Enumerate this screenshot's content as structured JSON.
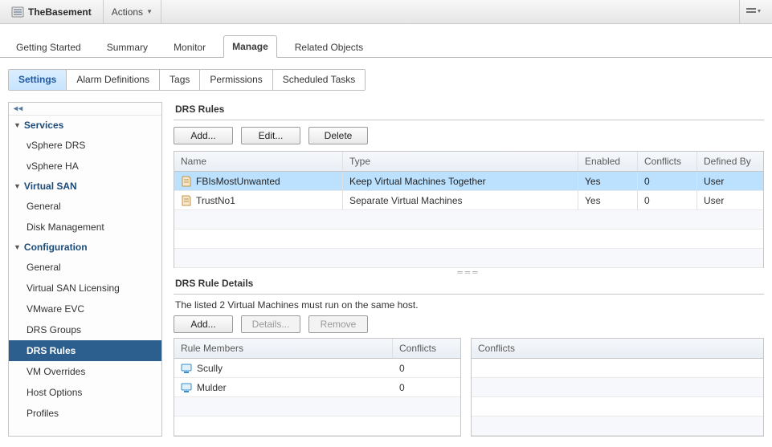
{
  "header": {
    "title": "TheBasement",
    "actions_label": "Actions"
  },
  "main_tabs": [
    {
      "label": "Getting Started",
      "active": false
    },
    {
      "label": "Summary",
      "active": false
    },
    {
      "label": "Monitor",
      "active": false
    },
    {
      "label": "Manage",
      "active": true
    },
    {
      "label": "Related Objects",
      "active": false
    }
  ],
  "sub_tabs": [
    {
      "label": "Settings",
      "active": true
    },
    {
      "label": "Alarm Definitions",
      "active": false
    },
    {
      "label": "Tags",
      "active": false
    },
    {
      "label": "Permissions",
      "active": false
    },
    {
      "label": "Scheduled Tasks",
      "active": false
    }
  ],
  "sidebar": {
    "sections": [
      {
        "label": "Services",
        "items": [
          {
            "label": "vSphere DRS"
          },
          {
            "label": "vSphere HA"
          }
        ]
      },
      {
        "label": "Virtual SAN",
        "items": [
          {
            "label": "General"
          },
          {
            "label": "Disk Management"
          }
        ]
      },
      {
        "label": "Configuration",
        "items": [
          {
            "label": "General"
          },
          {
            "label": "Virtual SAN Licensing"
          },
          {
            "label": "VMware EVC"
          },
          {
            "label": "DRS Groups"
          },
          {
            "label": "DRS Rules",
            "active": true
          },
          {
            "label": "VM Overrides"
          },
          {
            "label": "Host Options"
          },
          {
            "label": "Profiles"
          }
        ]
      }
    ]
  },
  "rules_panel": {
    "title": "DRS Rules",
    "toolbar": {
      "add": "Add...",
      "edit": "Edit...",
      "delete": "Delete"
    },
    "columns": {
      "name": "Name",
      "type": "Type",
      "enabled": "Enabled",
      "conflicts": "Conflicts",
      "definedby": "Defined By"
    },
    "rows": [
      {
        "name": "FBIsMostUnwanted",
        "type": "Keep Virtual Machines Together",
        "enabled": "Yes",
        "conflicts": "0",
        "definedby": "User",
        "selected": true
      },
      {
        "name": "TrustNo1",
        "type": "Separate Virtual Machines",
        "enabled": "Yes",
        "conflicts": "0",
        "definedby": "User",
        "selected": false
      }
    ]
  },
  "details_panel": {
    "title": "DRS Rule Details",
    "description": "The listed 2 Virtual Machines must run on the same host.",
    "toolbar": {
      "add": "Add...",
      "details": "Details...",
      "remove": "Remove"
    },
    "members_columns": {
      "name": "Rule Members",
      "conflicts": "Conflicts"
    },
    "members": [
      {
        "name": "Scully",
        "conflicts": "0"
      },
      {
        "name": "Mulder",
        "conflicts": "0"
      }
    ],
    "conflicts_column": "Conflicts"
  }
}
